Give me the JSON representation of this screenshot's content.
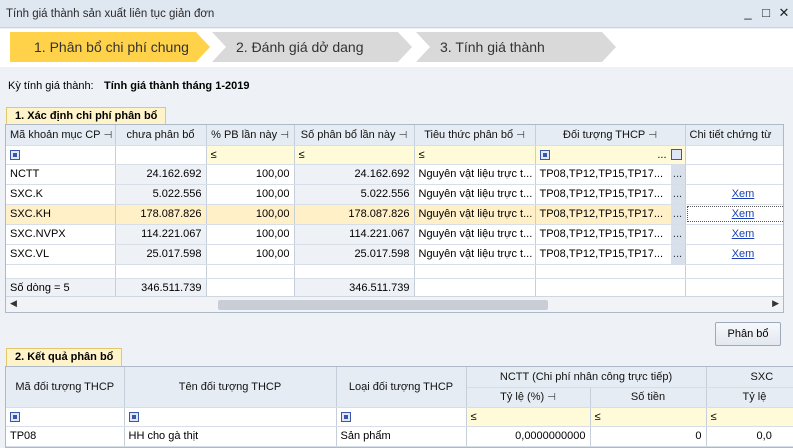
{
  "window": {
    "title": "Tính giá thành sản xuất liên tục giản đơn",
    "minimize": "_",
    "maximize": "□",
    "close": "✕"
  },
  "steps": [
    {
      "label": "1. Phân bổ chi phí chung",
      "active": true
    },
    {
      "label": "2. Đánh giá dở dang",
      "active": false
    },
    {
      "label": "3. Tính giá thành",
      "active": false
    }
  ],
  "period": {
    "label": "Kỳ tính giá thành:",
    "value": "Tính giá thành tháng 1-2019"
  },
  "section1": {
    "title": "1. Xác định chi phí phân bổ",
    "columns": [
      "Mã khoản mục CP",
      "chưa phân bổ",
      "% PB lần này",
      "Số phân bổ lần này",
      "Tiêu thức phân bổ",
      "Đối tượng THCP",
      "Chi tiết chứng từ"
    ],
    "filter_op": "≤",
    "rows": [
      {
        "code": "NCTT",
        "unallocated": "24.162.692",
        "percent": "100,00",
        "amount": "24.162.692",
        "criteria": "Nguyên vật liệu trực t...",
        "objects": "TP08,TP12,TP15,TP17...",
        "link": ""
      },
      {
        "code": "SXC.K",
        "unallocated": "5.022.556",
        "percent": "100,00",
        "amount": "5.022.556",
        "criteria": "Nguyên vật liệu trực t...",
        "objects": "TP08,TP12,TP15,TP17...",
        "link": "Xem"
      },
      {
        "code": "SXC.KH",
        "unallocated": "178.087.826",
        "percent": "100,00",
        "amount": "178.087.826",
        "criteria": "Nguyên vật liệu trực t...",
        "objects": "TP08,TP12,TP15,TP17...",
        "link": "Xem"
      },
      {
        "code": "SXC.NVPX",
        "unallocated": "114.221.067",
        "percent": "100,00",
        "amount": "114.221.067",
        "criteria": "Nguyên vật liệu trực t...",
        "objects": "TP08,TP12,TP15,TP17...",
        "link": "Xem"
      },
      {
        "code": "SXC.VL",
        "unallocated": "25.017.598",
        "percent": "100,00",
        "amount": "25.017.598",
        "criteria": "Nguyên vật liệu trực t...",
        "objects": "TP08,TP12,TP15,TP17...",
        "link": "Xem"
      }
    ],
    "footer": {
      "count": "Số dòng = 5",
      "total_unallocated": "346.511.739",
      "total_amount": "346.511.739"
    },
    "allocate_button": "Phân bổ"
  },
  "section2": {
    "title": "2. Kết quả phân bổ",
    "columns": {
      "code": "Mã đối tượng THCP",
      "name": "Tên đối tượng THCP",
      "type": "Loại đối tượng THCP",
      "group1": "NCTT (Chi phí nhân công trực tiếp)",
      "rate": "Tỷ lệ (%)",
      "amount": "Số tiền",
      "group2": "SXC",
      "rate2": "Tỷ lệ"
    },
    "filter_op": "≤",
    "rows": [
      {
        "code": "TP08",
        "name": "HH cho gà thịt",
        "type": "Sản phẩm",
        "rate": "0,0000000000",
        "amount": "0",
        "rate2": "0,0"
      }
    ]
  }
}
